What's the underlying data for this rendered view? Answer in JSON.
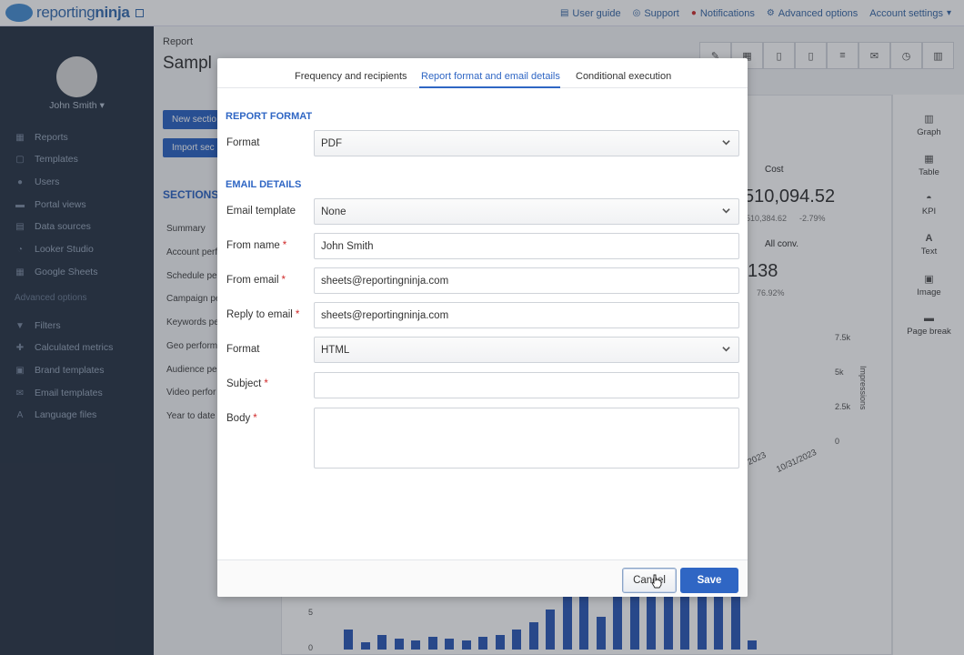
{
  "app": {
    "logo_text_light": "reporting",
    "logo_text_bold": "ninja"
  },
  "topnav": {
    "items": [
      {
        "label": "User guide",
        "icon": "book-icon"
      },
      {
        "label": "Support",
        "icon": "lifebuoy-icon"
      },
      {
        "label": "Notifications",
        "icon": "bell-icon"
      },
      {
        "label": "Advanced options",
        "icon": "gear-icon"
      },
      {
        "label": "Account settings",
        "icon": "chevron-down-icon"
      }
    ]
  },
  "sidebar": {
    "user": "John Smith",
    "items": [
      {
        "label": "Reports",
        "icon": "report-icon"
      },
      {
        "label": "Templates",
        "icon": "template-icon"
      },
      {
        "label": "Users",
        "icon": "user-icon"
      },
      {
        "label": "Portal views",
        "icon": "folder-icon"
      },
      {
        "label": "Data sources",
        "icon": "database-icon"
      },
      {
        "label": "Looker Studio",
        "icon": "chart-icon"
      },
      {
        "label": "Google Sheets",
        "icon": "sheet-icon"
      }
    ],
    "advanced_heading": "Advanced options",
    "advanced_items": [
      {
        "label": "Filters",
        "icon": "filter-icon"
      },
      {
        "label": "Calculated metrics",
        "icon": "plus-icon"
      },
      {
        "label": "Brand templates",
        "icon": "brand-icon"
      },
      {
        "label": "Email templates",
        "icon": "mail-icon"
      },
      {
        "label": "Language files",
        "icon": "language-icon"
      }
    ]
  },
  "main": {
    "report_label": "Report",
    "report_title": "Sampl",
    "new_section": "New sectio",
    "import_section": "Import sec",
    "sections_label": "SECTIONS",
    "sections": [
      "Summary",
      "Account perf",
      "Schedule pe",
      "Campaign pe",
      "Keywords pe",
      "Geo perform",
      "Audience pe",
      "Video perfor",
      "Year to date"
    ],
    "rail": [
      {
        "label": "Graph",
        "icon": "bar-chart-icon"
      },
      {
        "label": "Table",
        "icon": "table-icon"
      },
      {
        "label": "KPI",
        "icon": "gauge-icon"
      },
      {
        "label": "Text",
        "icon": "text-icon"
      },
      {
        "label": "Image",
        "icon": "image-icon"
      },
      {
        "label": "Page break",
        "icon": "page-break-icon"
      }
    ],
    "kpis": [
      {
        "name": "Cost",
        "value": "510,094.52",
        "sub1": "510,384.62",
        "sub2": "-2.79%"
      },
      {
        "name": "All conv.",
        "value": "138",
        "sub1": "",
        "sub2": "76.92%"
      }
    ],
    "axis_right_ticks": [
      "7.5k",
      "5k",
      "2.5k",
      "0"
    ],
    "axis_right_label": "Impressions",
    "date_ticks": [
      "/2023",
      "10/31/2023"
    ],
    "bar_axis_ticks": [
      "5",
      "0"
    ]
  },
  "modal": {
    "tabs": [
      {
        "label": "Frequency and recipients",
        "active": false
      },
      {
        "label": "Report format and email details",
        "active": true
      },
      {
        "label": "Conditional execution",
        "active": false
      }
    ],
    "report_format_title": "REPORT FORMAT",
    "format_label": "Format",
    "format_value": "PDF",
    "email_details_title": "EMAIL DETAILS",
    "email_template_label": "Email template",
    "email_template_value": "None",
    "from_name_label": "From name",
    "from_name_value": "John Smith",
    "from_email_label": "From email",
    "from_email_value": "sheets@reportingninja.com",
    "reply_to_label": "Reply to email",
    "reply_to_value": "sheets@reportingninja.com",
    "email_format_label": "Format",
    "email_format_value": "HTML",
    "subject_label": "Subject",
    "subject_value": "",
    "body_label": "Body",
    "body_value": "",
    "required_mark": "*",
    "cancel_label": "Cancel",
    "save_label": "Save"
  },
  "colors": {
    "accent": "#2f66c4",
    "required": "#d02a2a",
    "sidebar_bg": "#2c3848"
  }
}
